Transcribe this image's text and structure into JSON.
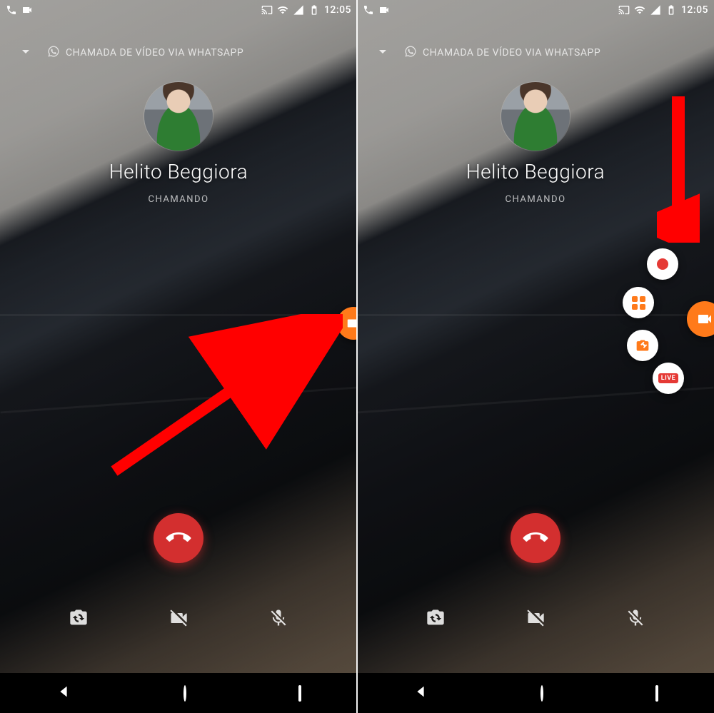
{
  "status": {
    "time": "12:05",
    "icons_left": [
      "phone-icon",
      "videocam-icon"
    ],
    "icons_right": [
      "cast-icon",
      "wifi-icon",
      "signal-icon",
      "battery-icon"
    ]
  },
  "call": {
    "header_label": "CHAMADA DE VÍDEO VIA WHATSAPP",
    "contact_name": "Helito Beggiora",
    "status_label": "CHAMANDO"
  },
  "controls": {
    "switch_camera": "switch-camera",
    "video_off": "video-off",
    "mic_off": "mic-off",
    "hangup": "hangup"
  },
  "recorder": {
    "main": "videocam",
    "options": {
      "record": "record",
      "apps": "apps",
      "tools": "tools",
      "live": "LIVE"
    }
  },
  "colors": {
    "accent_orange": "#ff7a1a",
    "hangup_red": "#d32f2f",
    "arrow_red": "#ff0000",
    "record_red": "#e53935"
  }
}
